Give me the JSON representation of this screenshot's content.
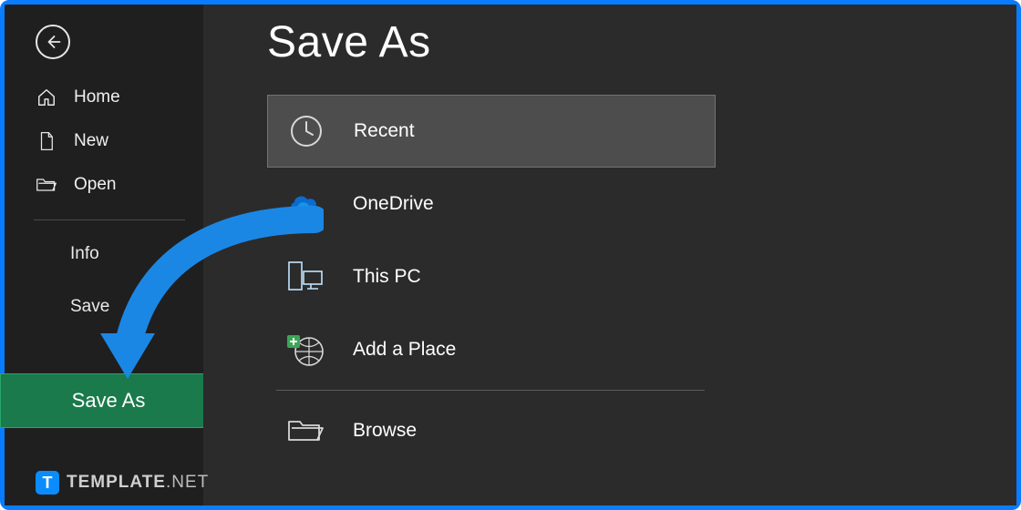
{
  "sidebar": {
    "items": [
      {
        "label": "Home"
      },
      {
        "label": "New"
      },
      {
        "label": "Open"
      }
    ],
    "sub": [
      {
        "label": "Info"
      },
      {
        "label": "Save"
      }
    ],
    "saveas_label": "Save As"
  },
  "main": {
    "title": "Save As",
    "locations": [
      {
        "label": "Recent"
      },
      {
        "label": "OneDrive"
      },
      {
        "label": "This PC"
      },
      {
        "label": "Add a Place"
      },
      {
        "label": "Browse"
      }
    ]
  },
  "watermark": {
    "badge": "T",
    "text_bold": "TEMPLATE",
    "text_thin": ".NET"
  },
  "colors": {
    "accent_green": "#1a7a4b",
    "frame_blue": "#0a7cff",
    "arrow_blue": "#1b87e5"
  }
}
